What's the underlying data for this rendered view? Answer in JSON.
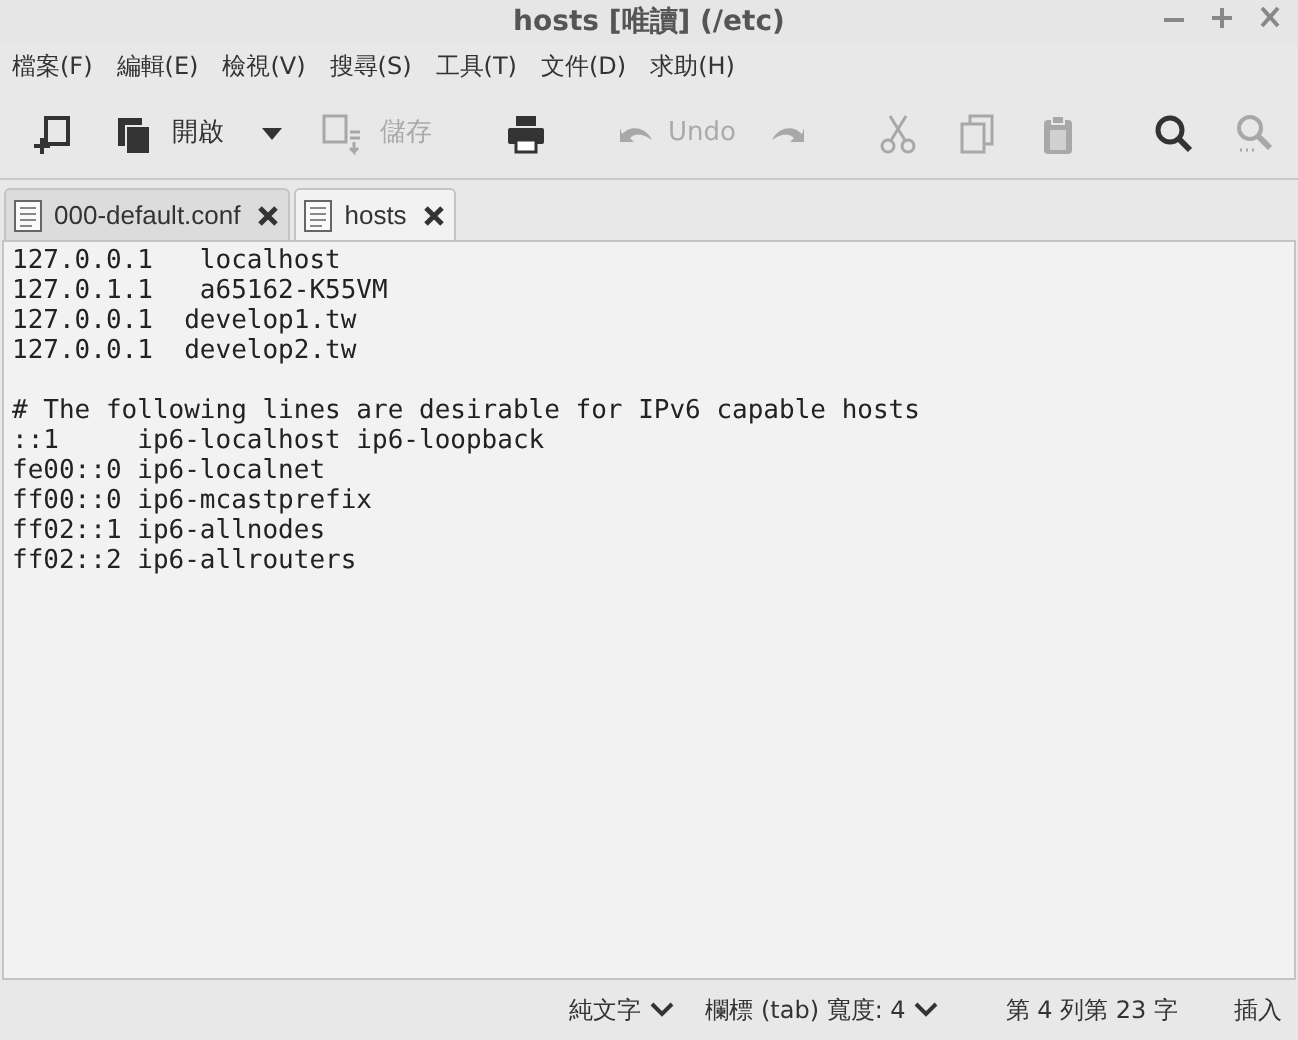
{
  "window": {
    "title": "hosts [唯讀] (/etc)"
  },
  "menu": [
    "檔案(F)",
    "編輯(E)",
    "檢視(V)",
    "搜尋(S)",
    "工具(T)",
    "文件(D)",
    "求助(H)"
  ],
  "toolbar": [
    {
      "kind": "new",
      "disabled": false
    },
    {
      "kind": "open",
      "label": "開啟",
      "disabled": false
    },
    {
      "kind": "dropdown",
      "disabled": false
    },
    {
      "kind": "save",
      "label": "儲存",
      "disabled": true
    },
    {
      "kind": "separator"
    },
    {
      "kind": "print",
      "disabled": false
    },
    {
      "kind": "separator"
    },
    {
      "kind": "undo",
      "label": "Undo",
      "disabled": true
    },
    {
      "kind": "redo",
      "disabled": true
    },
    {
      "kind": "separator"
    },
    {
      "kind": "cut",
      "disabled": true
    },
    {
      "kind": "copy",
      "disabled": true
    },
    {
      "kind": "paste",
      "disabled": true
    },
    {
      "kind": "separator"
    },
    {
      "kind": "find",
      "disabled": false
    },
    {
      "kind": "findnext",
      "disabled": true
    }
  ],
  "tabs": [
    {
      "label": "000-default.conf",
      "selected": false
    },
    {
      "label": "hosts",
      "selected": true
    }
  ],
  "editor": {
    "paragraphs": [
      [
        "127.0.0.1   localhost",
        "127.0.1.1   a65162-K55VM",
        "127.0.0.1  develop1.tw",
        "127.0.0.1  develop2.tw"
      ],
      [
        "# The following lines are desirable for IPv6 capable hosts",
        "::1     ip6-localhost ip6-loopback",
        "fe00::0 ip6-localnet",
        "ff00::0 ip6-mcastprefix",
        "ff02::1 ip6-allnodes",
        "ff02::2 ip6-allrouters"
      ]
    ]
  },
  "status_bar": {
    "syntax": "純文字",
    "tab_width": "欄標 (tab) 寬度: 4",
    "position": "第 4 列第 23 字",
    "mode": "插入"
  }
}
